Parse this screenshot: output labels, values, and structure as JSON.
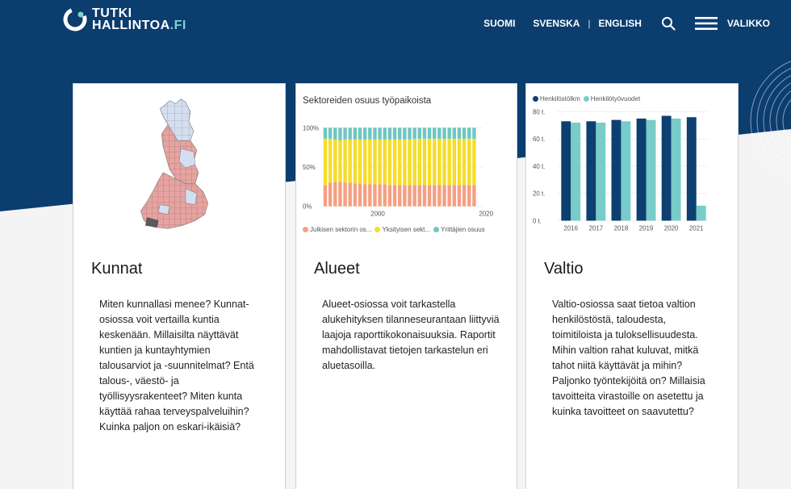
{
  "header": {
    "logo_line1": "TUTKI",
    "logo_line2": "HALLINTOA",
    "logo_suffix": ".FI",
    "nav": {
      "suomi": "SUOMI",
      "svenska": "SVENSKA",
      "separator": "|",
      "english": "ENGLISH",
      "menu_label": "VALIKKO"
    }
  },
  "colors": {
    "navy": "#0b3d6e",
    "accent_teal": "#7fd3d0",
    "public_sector": "#f4a082",
    "private_sector": "#f5dd2a",
    "entrepreneurs": "#6fc6c0",
    "staff_count": "#0d3f70",
    "person_years": "#78ccc9"
  },
  "cards": [
    {
      "title": "Kunnat",
      "text": "Miten kunnallasi menee? Kunnat-osiossa voit vertailla kuntia keskenään. Millaisilta näyttävät kuntien ja kuntayhtymien talousarviot ja -suunnitelmat? Entä talous-, väestö- ja työllisyysrakenteet? Miten kunta käyttää rahaa terveyspalveluihin? Kuinka paljon on eskari-ikäisiä?",
      "visual": "finland-municipality-map"
    },
    {
      "title": "Alueet",
      "text": "Alueet-osiossa voit tarkastella alukehityksen tilanneseurantaan liittyviä laajoja raporttikokonaisuuksia. Raportit mahdollistavat tietojen tarkastelun eri aluetasoilla."
    },
    {
      "title": "Valtio",
      "text": "Valtio-osiossa saat tietoa valtion henkilöstöstä, taloudesta, toimitiloista ja tuloksellisuudesta. Mihin valtion rahat kuluvat, mitkä tahot niitä käyttävät ja mihin? Paljonko työntekijöitä on? Millaisia tavoitteita virastoille on asetettu ja kuinka tavoitteet on saavutettu?"
    }
  ],
  "chart_data": [
    {
      "type": "bar",
      "stacked": true,
      "title": "Sektoreiden osuus työpaikoista",
      "x_ticks": [
        "2000",
        "2020"
      ],
      "y_ticks": [
        "0%",
        "50%",
        "100%"
      ],
      "ylim": [
        0,
        100
      ],
      "legend": [
        "Julkisen sektorin os...",
        "Yksityisen sekt...",
        "Yrittäjien osuus"
      ],
      "n_bars": 31,
      "series": [
        {
          "name": "Julkisen sektorin os...",
          "values": [
            27,
            30,
            31,
            31,
            30,
            30,
            29,
            29,
            28,
            28,
            28,
            28,
            28,
            27,
            27,
            27,
            27,
            27,
            27,
            27,
            27,
            27,
            27,
            27,
            27,
            27,
            27,
            27,
            27,
            27,
            27
          ]
        },
        {
          "name": "Yksityisen sekt...",
          "values": [
            59,
            56,
            54,
            53,
            55,
            55,
            56,
            56,
            57,
            57,
            57,
            57,
            57,
            58,
            58,
            58,
            58,
            58,
            59,
            59,
            59,
            59,
            59,
            59,
            59,
            59,
            59,
            59,
            59,
            59,
            59
          ]
        },
        {
          "name": "Yrittäjien osuus",
          "values": [
            14,
            14,
            15,
            16,
            15,
            15,
            15,
            15,
            15,
            15,
            15,
            15,
            15,
            15,
            15,
            15,
            15,
            15,
            14,
            14,
            14,
            14,
            14,
            14,
            14,
            14,
            14,
            14,
            14,
            14,
            14
          ]
        }
      ]
    },
    {
      "type": "bar",
      "categories": [
        "2016",
        "2017",
        "2018",
        "2019",
        "2020",
        "2021"
      ],
      "y_ticks": [
        "0 t.",
        "20 t.",
        "40 t.",
        "60 t.",
        "80 t."
      ],
      "ylim": [
        0,
        80
      ],
      "legend": [
        "Henkilöstölkm",
        "Henkilötyövuodet"
      ],
      "series": [
        {
          "name": "Henkilöstölkm",
          "values": [
            73,
            73,
            74,
            75,
            77,
            76
          ]
        },
        {
          "name": "Henkilötyövuodet",
          "values": [
            72,
            72,
            73,
            74,
            75,
            11
          ]
        }
      ]
    }
  ]
}
